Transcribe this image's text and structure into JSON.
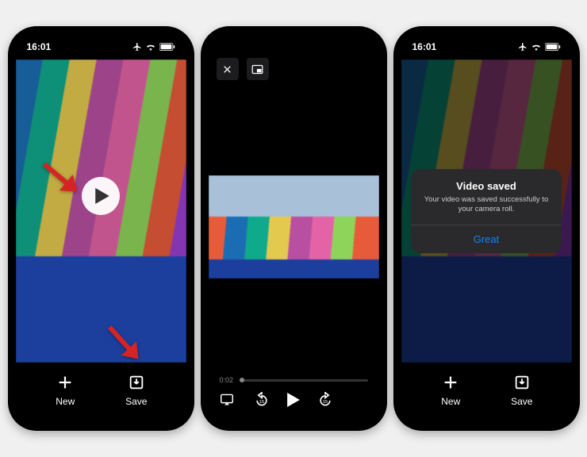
{
  "status": {
    "time": "16:01"
  },
  "phone1": {
    "new_label": "New",
    "save_label": "Save"
  },
  "phone2": {
    "playback_time": "0:02"
  },
  "phone3": {
    "new_label": "New",
    "save_label": "Save",
    "dialog": {
      "title": "Video saved",
      "message": "Your video was saved successfully to your camera roll.",
      "button": "Great"
    }
  },
  "colors": {
    "arrow": "#d62323",
    "accent": "#0a84ff"
  }
}
